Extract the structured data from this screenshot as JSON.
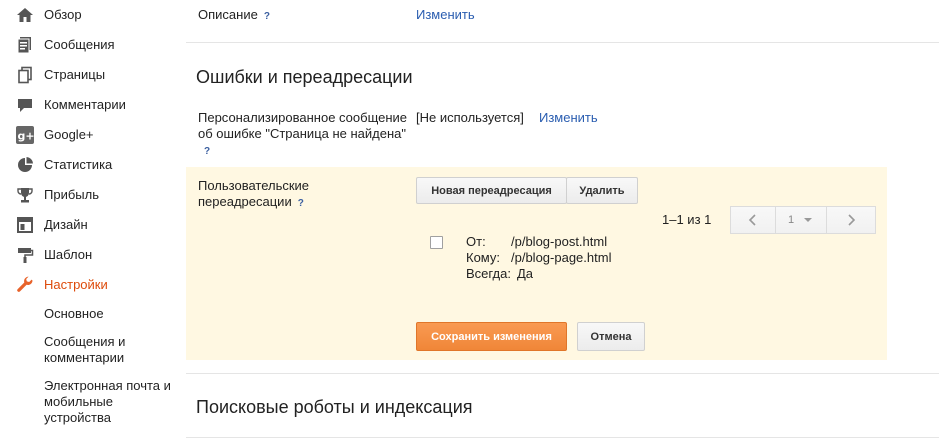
{
  "sidebar": {
    "items": [
      {
        "label": "Обзор",
        "icon": "home-icon"
      },
      {
        "label": "Сообщения",
        "icon": "posts-icon"
      },
      {
        "label": "Страницы",
        "icon": "pages-icon"
      },
      {
        "label": "Комментарии",
        "icon": "comments-icon"
      },
      {
        "label": "Google+",
        "icon": "google-plus-icon"
      },
      {
        "label": "Статистика",
        "icon": "stats-pie-icon"
      },
      {
        "label": "Прибыль",
        "icon": "trophy-icon"
      },
      {
        "label": "Дизайн",
        "icon": "layout-icon"
      },
      {
        "label": "Шаблон",
        "icon": "paint-roller-icon"
      },
      {
        "label": "Настройки",
        "icon": "wrench-icon"
      }
    ],
    "active_item": "Настройки",
    "subitems": [
      {
        "label": "Основное"
      },
      {
        "label": "Сообщения и комментарии"
      },
      {
        "label": "Электронная почта и мобильные устройства"
      }
    ]
  },
  "description_row": {
    "label": "Описание",
    "help": "?",
    "link": "Изменить"
  },
  "errors_section": {
    "title": "Ошибки и переадресации",
    "custom_404": {
      "label": "Персонализированное сообщение об ошибке \"Страница не найдена\"",
      "help": "?",
      "status": "[Не используется]",
      "link": "Изменить"
    },
    "custom_redirects": {
      "label": "Пользовательские переадресации",
      "help": "?",
      "new_button": "Новая переадресация",
      "delete_button": "Удалить",
      "pager_text": "1–1 из 1",
      "page_select": "1",
      "redirects": [
        {
          "from_label": "От:",
          "from": "/p/blog-post.html",
          "to_label": "Кому:",
          "to": "/p/blog-page.html",
          "always_label": "Всегда:",
          "always": "Да"
        }
      ],
      "save_button": "Сохранить изменения",
      "cancel_button": "Отмена"
    }
  },
  "crawlers_section": {
    "title": "Поисковые роботы и индексация"
  },
  "colors": {
    "accent": "#dd4b0b",
    "link": "#2a5db0",
    "highlight_bg": "#fff8e2",
    "primary_button": "#f08638"
  }
}
